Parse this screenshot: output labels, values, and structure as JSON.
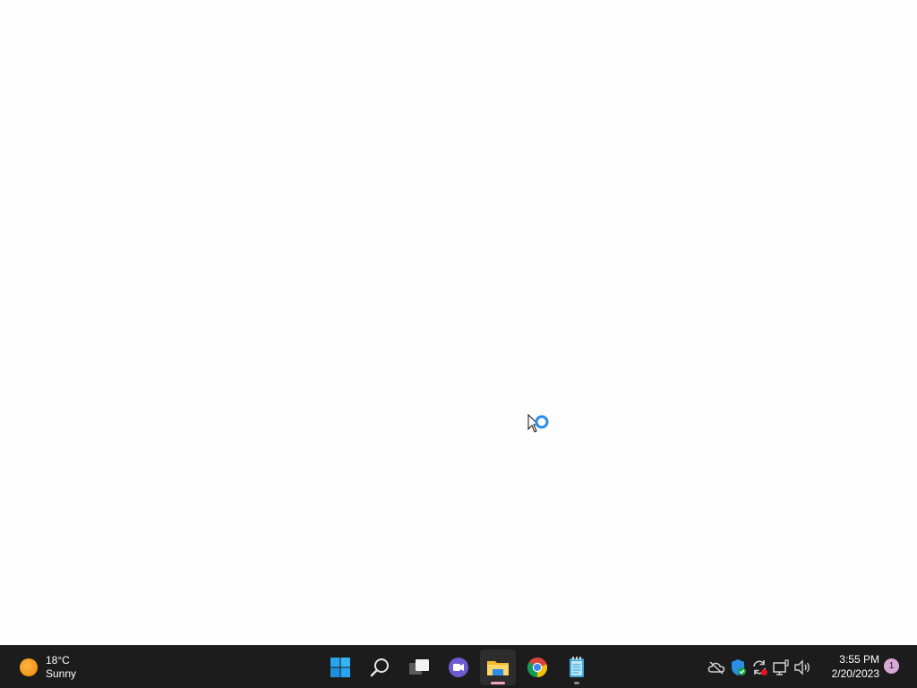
{
  "weather": {
    "temperature": "18°C",
    "condition": "Sunny",
    "icon": "sun-icon"
  },
  "taskbar": {
    "apps": [
      {
        "name": "Start",
        "icon": "windows-start-icon",
        "state": "idle"
      },
      {
        "name": "Search",
        "icon": "search-icon",
        "state": "idle"
      },
      {
        "name": "Task View",
        "icon": "task-view-icon",
        "state": "idle"
      },
      {
        "name": "Chat",
        "icon": "chat-icon",
        "state": "idle"
      },
      {
        "name": "File Explorer",
        "icon": "file-explorer-icon",
        "state": "focused"
      },
      {
        "name": "Google Chrome",
        "icon": "chrome-icon",
        "state": "idle"
      },
      {
        "name": "Notepad",
        "icon": "notepad-icon",
        "state": "running"
      }
    ]
  },
  "tray": {
    "icons": [
      "onedrive-offline-icon",
      "security-icon",
      "sync-icon",
      "network-icon",
      "volume-icon"
    ]
  },
  "clock": {
    "time": "3:55 PM",
    "date": "2/20/2023"
  },
  "notifications": {
    "count": "1"
  },
  "colors": {
    "taskbar_bg": "#1c1c1c",
    "desktop_bg": "#fdfdfd",
    "focus_indicator": "#f3a3c8",
    "start_blue": "#29a4f0"
  }
}
